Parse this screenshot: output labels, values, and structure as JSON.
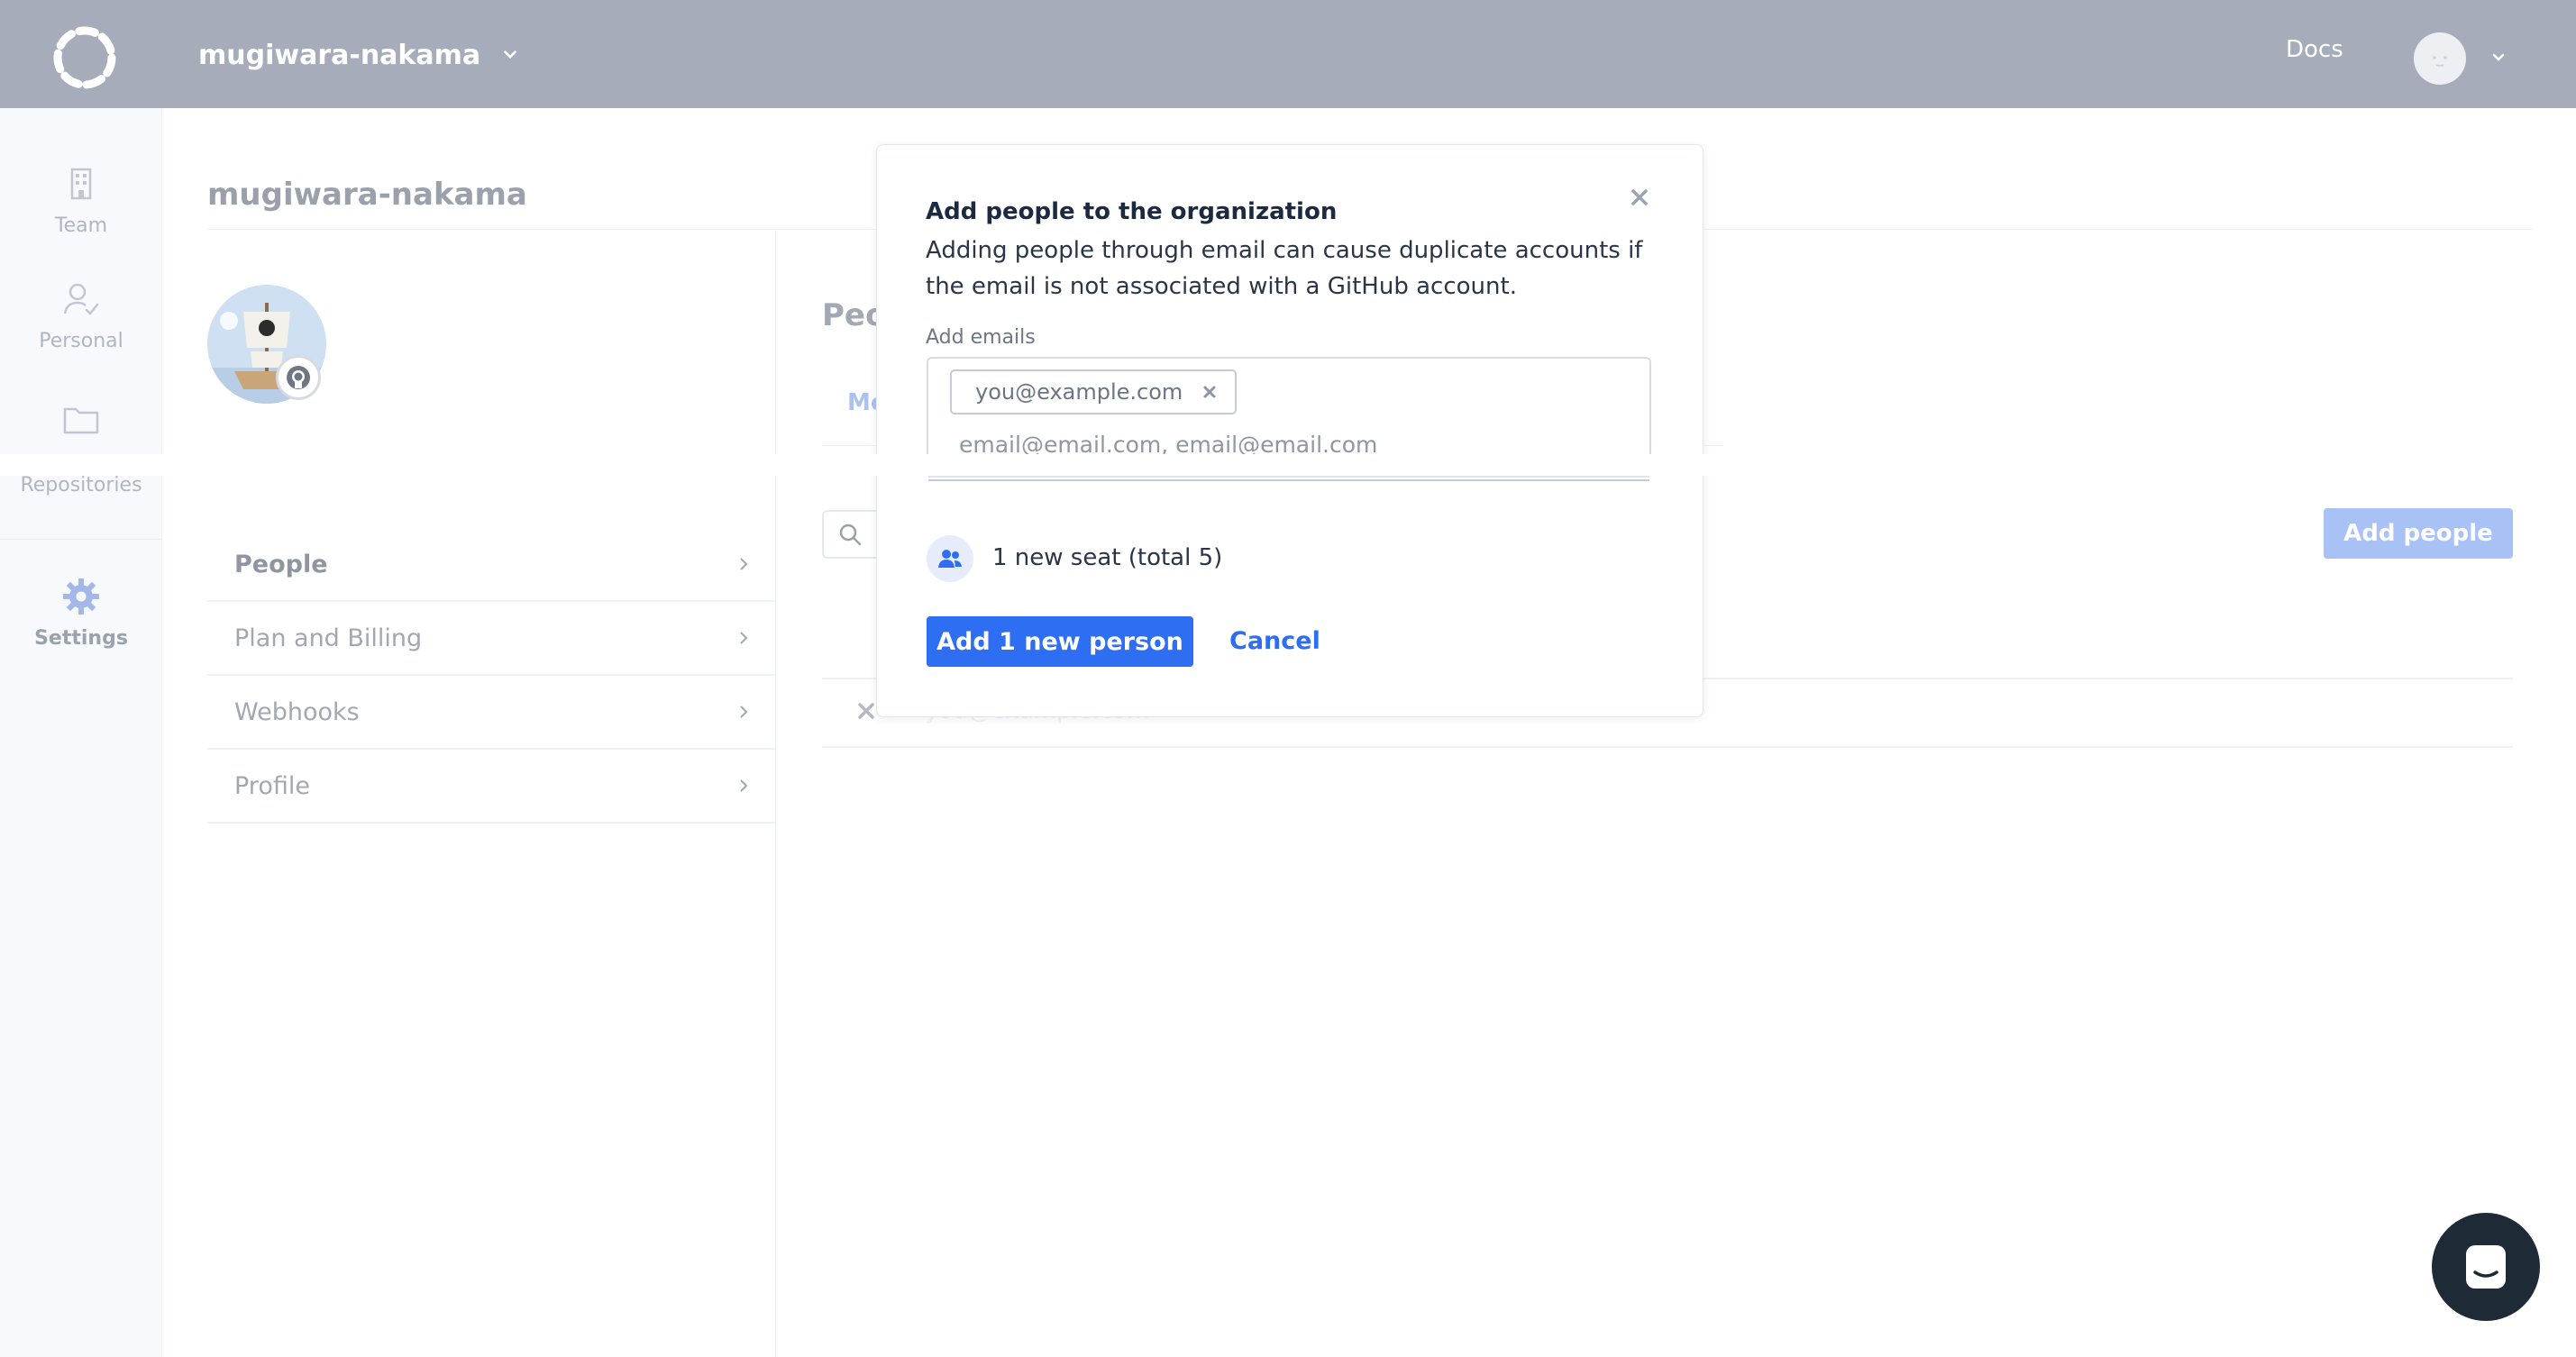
{
  "topbar": {
    "org_name": "mugiwara-nakama",
    "docs_label": "Docs",
    "bg_color": "#a6acb9"
  },
  "rail": {
    "items": [
      {
        "label": "Team",
        "icon": "building-icon"
      },
      {
        "label": "Personal",
        "icon": "user-icon"
      },
      {
        "label": "Repositories",
        "icon": "folder-icon"
      },
      {
        "label": "Settings",
        "icon": "gear-icon",
        "active": true
      }
    ]
  },
  "page": {
    "title": "mugiwara-nakama",
    "people_heading": "Peo",
    "tab_peek": "Me",
    "add_people_label": "Add people",
    "row_email_peek": "you@example.com"
  },
  "settings_nav": [
    {
      "label": "People",
      "active": true
    },
    {
      "label": "Plan and Billing"
    },
    {
      "label": "Webhooks"
    },
    {
      "label": "Profile"
    }
  ],
  "modal": {
    "title": "Add people to the organization",
    "description": "Adding people through email can cause duplicate accounts if the email is not associated with a GitHub account.",
    "emails_label": "Add emails",
    "chip_email": "you@example.com",
    "emails_placeholder": "email@email.com, email@email.com",
    "seat_summary": "1 new seat (total 5)",
    "primary_label": "Add 1 new person",
    "cancel_label": "Cancel",
    "accent_color": "#2e6ef2"
  }
}
